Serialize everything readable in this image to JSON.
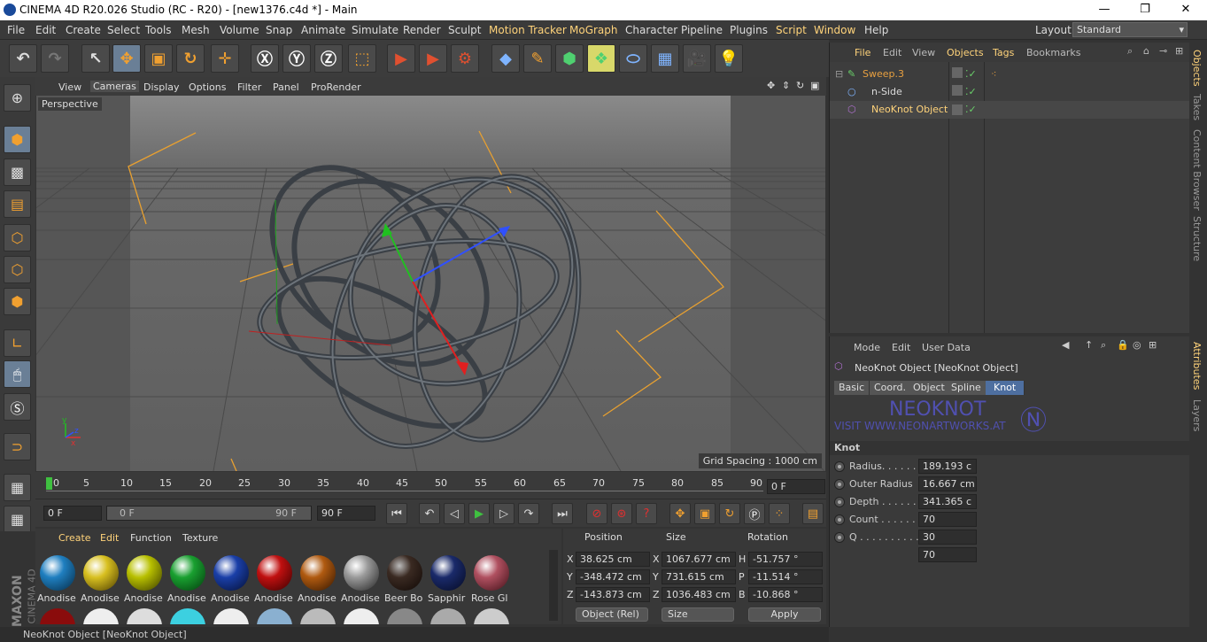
{
  "window": {
    "title": "CINEMA 4D R20.026 Studio (RC - R20) - [new1376.c4d *] - Main",
    "btn_min": "—",
    "btn_max": "❐",
    "btn_close": "✕"
  },
  "menu": [
    {
      "label": "File"
    },
    {
      "label": "Edit"
    },
    {
      "label": "Create"
    },
    {
      "label": "Select"
    },
    {
      "label": "Tools"
    },
    {
      "label": "Mesh"
    },
    {
      "label": "Volume"
    },
    {
      "label": "Snap"
    },
    {
      "label": "Animate"
    },
    {
      "label": "Simulate"
    },
    {
      "label": "Render"
    },
    {
      "label": "Sculpt"
    },
    {
      "label": "Motion Tracker"
    },
    {
      "label": "MoGraph"
    },
    {
      "label": "Character"
    },
    {
      "label": "Pipeline"
    },
    {
      "label": "Plugins"
    },
    {
      "label": "Script"
    },
    {
      "label": "Window"
    },
    {
      "label": "Help"
    }
  ],
  "layout": {
    "label": "Layout:",
    "value": "Standard"
  },
  "viewport": {
    "menu": [
      {
        "label": "View"
      },
      {
        "label": "Cameras"
      },
      {
        "label": "Display"
      },
      {
        "label": "Options"
      },
      {
        "label": "Filter"
      },
      {
        "label": "Panel"
      },
      {
        "label": "ProRender"
      }
    ],
    "camera": "Perspective",
    "grid_spacing": "Grid Spacing : 1000 cm",
    "axis_y": "y",
    "axis_z": "z",
    "axis_x": "x"
  },
  "timeline": {
    "ticks": [
      "0",
      "5",
      "10",
      "15",
      "20",
      "25",
      "30",
      "35",
      "40",
      "45",
      "50",
      "55",
      "60",
      "65",
      "70",
      "75",
      "80",
      "85",
      "90"
    ],
    "current_frame": "0 F"
  },
  "transport": {
    "start_field": "0 F",
    "range_start": "0 F",
    "range_end": "90 F",
    "end_field": "90 F"
  },
  "materials": {
    "menu": [
      {
        "label": "Create"
      },
      {
        "label": "Edit"
      },
      {
        "label": "Function"
      },
      {
        "label": "Texture"
      }
    ],
    "items": [
      {
        "label": "Anodise",
        "color": "#1f7fc0"
      },
      {
        "label": "Anodise",
        "color": "#d8c020"
      },
      {
        "label": "Anodise",
        "color": "#b8c000"
      },
      {
        "label": "Anodise",
        "color": "#19a030"
      },
      {
        "label": "Anodise",
        "color": "#1a3fa8"
      },
      {
        "label": "Anodise",
        "color": "#c01010"
      },
      {
        "label": "Anodise",
        "color": "#b05a10"
      },
      {
        "label": "Anodise",
        "color": "#9a9a9a"
      },
      {
        "label": "Beer Bo",
        "color": "#3a2a22"
      },
      {
        "label": "Sapphir",
        "color": "#1a2a6a"
      },
      {
        "label": "Rose Gl",
        "color": "#b05060"
      }
    ]
  },
  "coordinates": {
    "headers": {
      "position": "Position",
      "size": "Size",
      "rotation": "Rotation"
    },
    "rows": [
      {
        "axis": "X",
        "pos": "38.625 cm",
        "size_axis": "X",
        "size": "1067.677 cm",
        "rot_axis": "H",
        "rot": "-51.757 °"
      },
      {
        "axis": "Y",
        "pos": "-348.472 cm",
        "size_axis": "Y",
        "size": "731.615 cm",
        "rot_axis": "P",
        "rot": "-11.514 °"
      },
      {
        "axis": "Z",
        "pos": "-143.873 cm",
        "size_axis": "Z",
        "size": "1036.483 cm",
        "rot_axis": "B",
        "rot": "-10.868 °"
      }
    ],
    "mode": "Object (Rel)",
    "size_mode": "Size",
    "apply": "Apply"
  },
  "status": "NeoKnot Object [NeoKnot Object]",
  "logo": {
    "maxon": "MAXON",
    "cinema": "CINEMA 4D"
  },
  "objects": {
    "menu": [
      {
        "label": "File"
      },
      {
        "label": "Edit"
      },
      {
        "label": "View"
      },
      {
        "label": "Objects"
      },
      {
        "label": "Tags"
      },
      {
        "label": "Bookmarks"
      }
    ],
    "items": [
      {
        "name": "Sweep.3",
        "color": "#e8a040"
      },
      {
        "name": "n-Side",
        "color": "#dddddd"
      },
      {
        "name": "NeoKnot Object",
        "color": "#ffd37a"
      }
    ]
  },
  "attributes": {
    "menu": [
      {
        "label": "Mode"
      },
      {
        "label": "Edit"
      },
      {
        "label": "User Data"
      }
    ],
    "object_title": "NeoKnot Object [NeoKnot Object]",
    "tabs": [
      {
        "label": "Basic"
      },
      {
        "label": "Coord."
      },
      {
        "label": "Object"
      },
      {
        "label": "Spline"
      },
      {
        "label": "Knot"
      }
    ],
    "banner_title": "NEOKNOT",
    "banner_url": "VISIT WWW.NEONARTWORKS.AT",
    "section": "Knot",
    "params": [
      {
        "label": "Radius. . . . . .",
        "value": "189.193 c"
      },
      {
        "label": "Outer Radius",
        "value": "16.667 cm"
      },
      {
        "label": "Depth . . . . . .",
        "value": "341.365 c"
      },
      {
        "label": "Count . . . . . .",
        "value": "70"
      },
      {
        "label": "Q . . . . . . . . . .",
        "value": "30"
      }
    ],
    "extra_value": "70"
  },
  "side_tabs": [
    {
      "label": "Objects"
    },
    {
      "label": "Takes"
    },
    {
      "label": "Content Browser"
    },
    {
      "label": "Structure"
    },
    {
      "label": "Attributes"
    },
    {
      "label": "Layers"
    }
  ]
}
